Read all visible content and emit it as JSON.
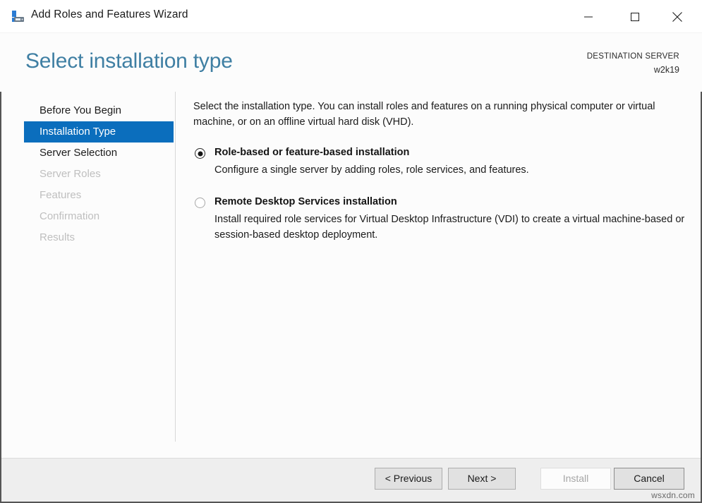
{
  "window": {
    "title": "Add Roles and Features Wizard",
    "icon": "server-roles-icon",
    "controls": {
      "minimize": "minimize-icon",
      "maximize": "maximize-icon",
      "close": "close-icon"
    }
  },
  "header": {
    "page_title": "Select installation type",
    "destination_label": "DESTINATION SERVER",
    "destination_value": "w2k19",
    "title_color": "#3f7fa3"
  },
  "sidebar": {
    "items": [
      {
        "label": "Before You Begin",
        "state": "enabled"
      },
      {
        "label": "Installation Type",
        "state": "active"
      },
      {
        "label": "Server Selection",
        "state": "enabled"
      },
      {
        "label": "Server Roles",
        "state": "disabled"
      },
      {
        "label": "Features",
        "state": "disabled"
      },
      {
        "label": "Confirmation",
        "state": "disabled"
      },
      {
        "label": "Results",
        "state": "disabled"
      }
    ],
    "active_color": "#0b6ebd"
  },
  "main": {
    "intro": "Select the installation type. You can install roles and features on a running physical computer or virtual machine, or on an offline virtual hard disk (VHD).",
    "options": [
      {
        "title": "Role-based or feature-based installation",
        "description": "Configure a single server by adding roles, role services, and features.",
        "selected": true
      },
      {
        "title": "Remote Desktop Services installation",
        "description": "Install required role services for Virtual Desktop Infrastructure (VDI) to create a virtual machine-based or session-based desktop deployment.",
        "selected": false
      }
    ]
  },
  "footer": {
    "buttons": [
      {
        "label": "< Previous",
        "enabled": true
      },
      {
        "label": "Next >",
        "enabled": true
      },
      {
        "label": "Install",
        "enabled": false
      },
      {
        "label": "Cancel",
        "enabled": true
      }
    ]
  },
  "watermark": "wsxdn.com"
}
